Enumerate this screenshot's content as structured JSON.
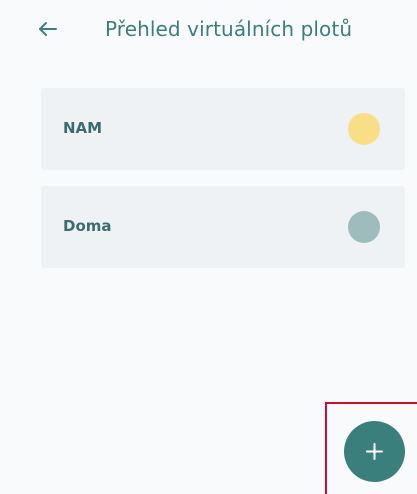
{
  "header": {
    "title": "Přehled virtuálních plotů",
    "back_icon": "arrow-left-icon"
  },
  "fences": [
    {
      "label": "NAM",
      "color": "#f7de87"
    },
    {
      "label": "Doma",
      "color": "#9fbcbc"
    }
  ],
  "fab": {
    "icon": "plus-icon",
    "color": "#3a7f7c"
  },
  "colors": {
    "accent": "#3a7f7c",
    "card_background": "#eff2f5",
    "highlight_border": "#c8102e"
  }
}
